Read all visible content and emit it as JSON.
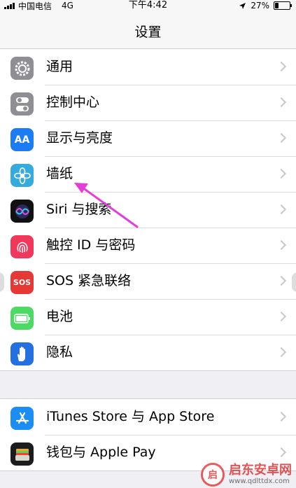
{
  "status_bar": {
    "carrier": "中国电信",
    "network": "4G",
    "time": "下午4:42",
    "battery_percent": "27%",
    "battery_level": 0.27,
    "icons": [
      "signal-icon",
      "location-icon",
      "battery-icon"
    ]
  },
  "nav": {
    "title": "设置"
  },
  "groups": [
    {
      "items": [
        {
          "label": "通用",
          "icon": "gear-icon",
          "color": "#8e8e93"
        },
        {
          "label": "控制中心",
          "icon": "toggles-icon",
          "color": "#8e8e93"
        },
        {
          "label": "显示与亮度",
          "icon": "text-size-icon",
          "color": "#1e7cf2",
          "glyph": "AA"
        },
        {
          "label": "墙纸",
          "icon": "flower-icon",
          "color": "#35aadc"
        },
        {
          "label": "Siri 与搜索",
          "icon": "siri-icon",
          "color": "#111111"
        },
        {
          "label": "触控 ID 与密码",
          "icon": "fingerprint-icon",
          "color": "#f0395a"
        },
        {
          "label": "SOS 紧急联络",
          "icon": "sos-icon",
          "color": "#e53935",
          "glyph": "SOS"
        },
        {
          "label": "电池",
          "icon": "battery-icon",
          "color": "#4cd964"
        },
        {
          "label": "隐私",
          "icon": "hand-icon",
          "color": "#2470e0"
        }
      ]
    },
    {
      "items": [
        {
          "label": "iTunes Store 与 App Store",
          "icon": "app-store-icon",
          "color": "#1c8ef3"
        },
        {
          "label": "钱包与 Apple Pay",
          "icon": "wallet-icon",
          "color": "#1c1c1e"
        }
      ]
    }
  ],
  "annotation": {
    "arrow_color": "#e53bd8"
  },
  "watermark": {
    "title": "启东安卓网",
    "url": "www.qdlttdx.com",
    "logo_glyph": "启"
  }
}
